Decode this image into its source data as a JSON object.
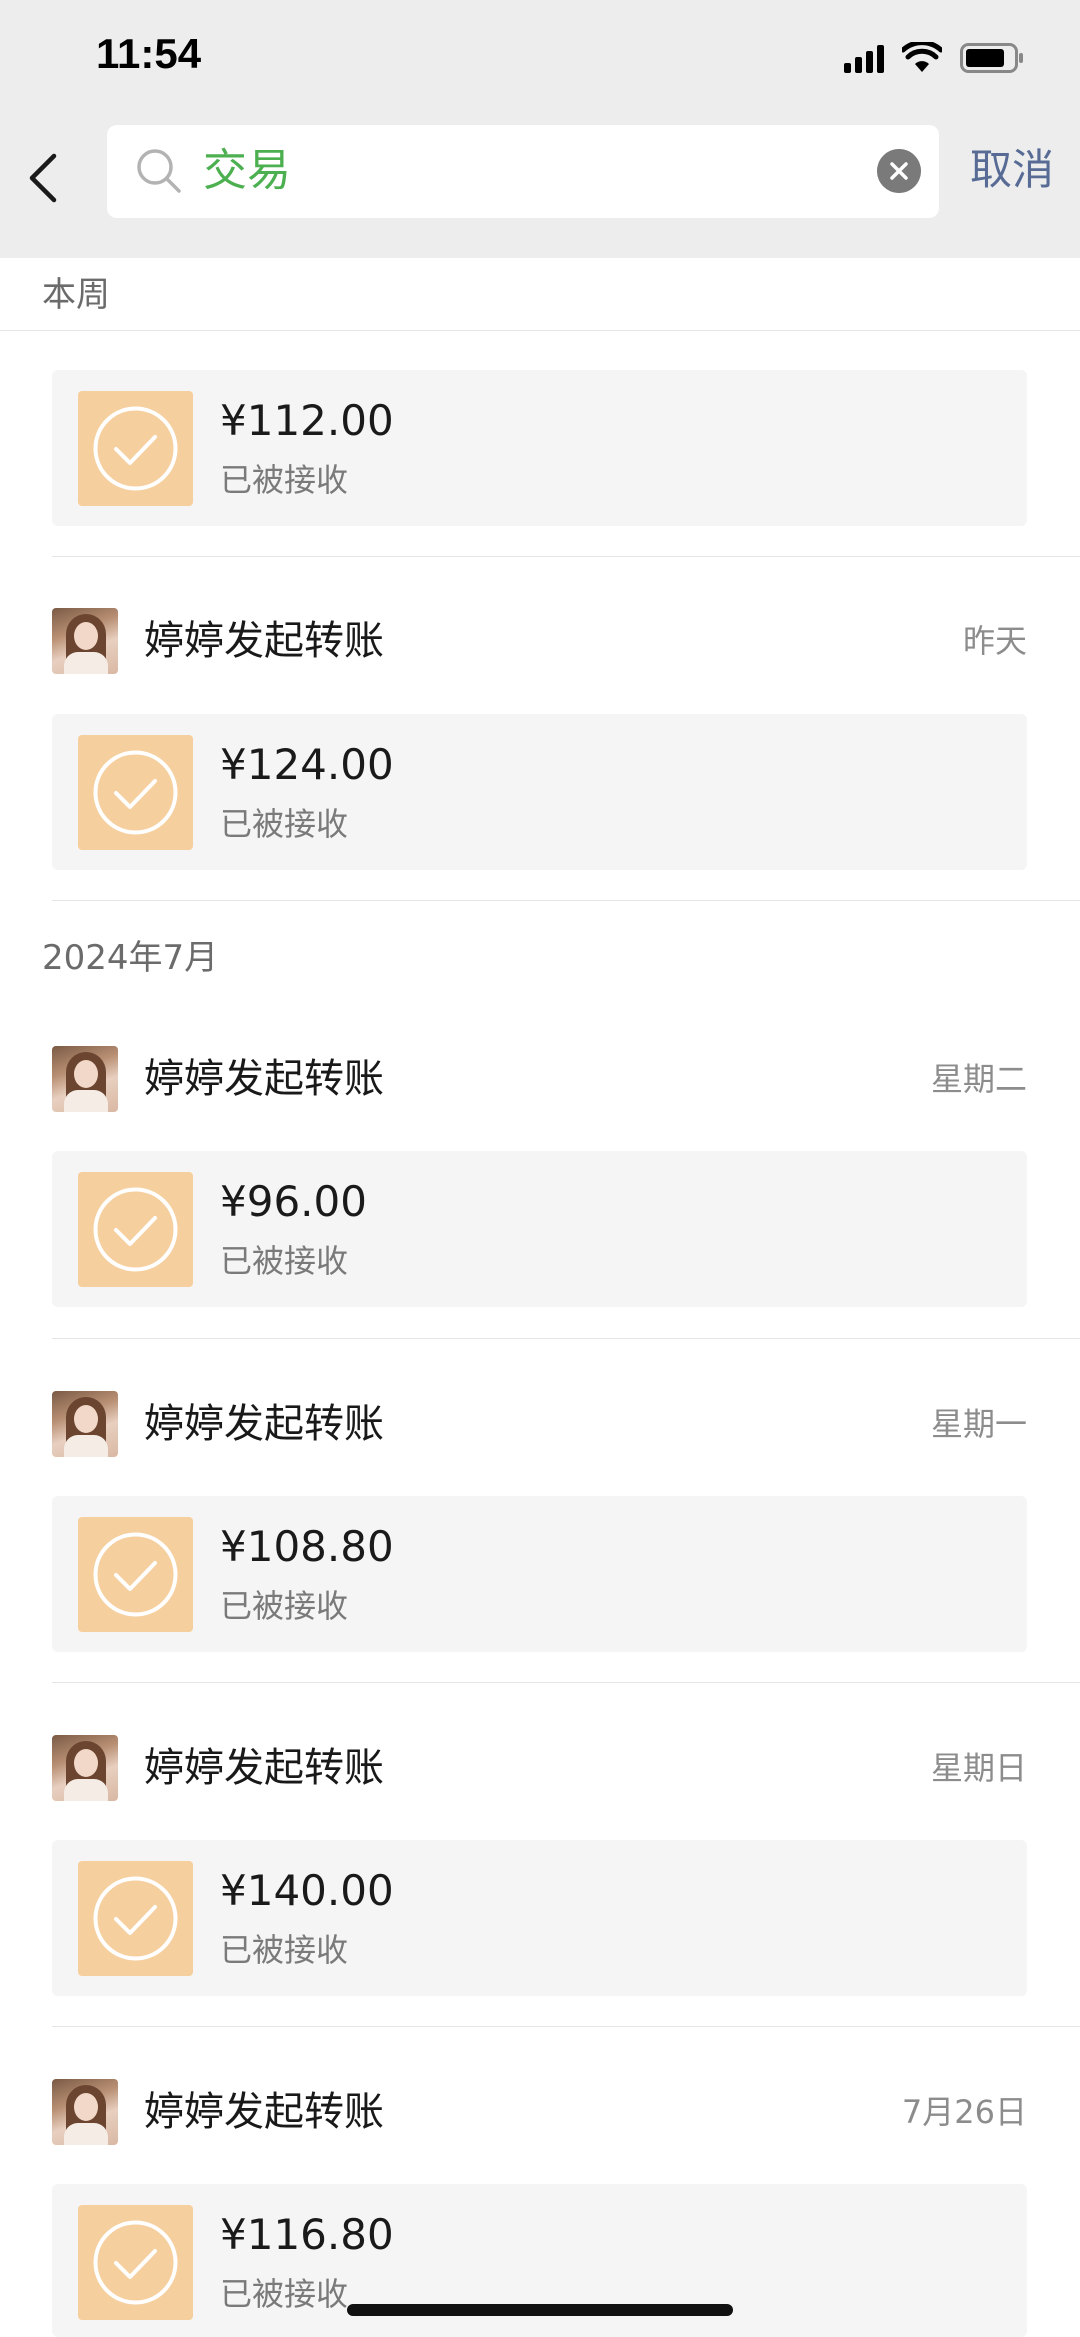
{
  "status_bar": {
    "time": "11:54"
  },
  "search": {
    "query": "交易",
    "cancel_label": "取消"
  },
  "sections": {
    "this_week": "本周",
    "july_2024": "2024年7月"
  },
  "transfers": [
    {
      "title": "",
      "date": "",
      "amount": "¥112.00",
      "status": "已被接收"
    },
    {
      "title": "婷婷发起转账",
      "date": "昨天",
      "amount": "¥124.00",
      "status": "已被接收"
    },
    {
      "title": "婷婷发起转账",
      "date": "星期二",
      "amount": "¥96.00",
      "status": "已被接收"
    },
    {
      "title": "婷婷发起转账",
      "date": "星期一",
      "amount": "¥108.80",
      "status": "已被接收"
    },
    {
      "title": "婷婷发起转账",
      "date": "星期日",
      "amount": "¥140.00",
      "status": "已被接收"
    },
    {
      "title": "婷婷发起转账",
      "date": "7月26日",
      "amount": "¥116.80",
      "status": "已被接收"
    }
  ],
  "colors": {
    "search_highlight": "#4caf50",
    "cancel_link": "#576b95",
    "transfer_card_icon": "#f6cf9f"
  }
}
